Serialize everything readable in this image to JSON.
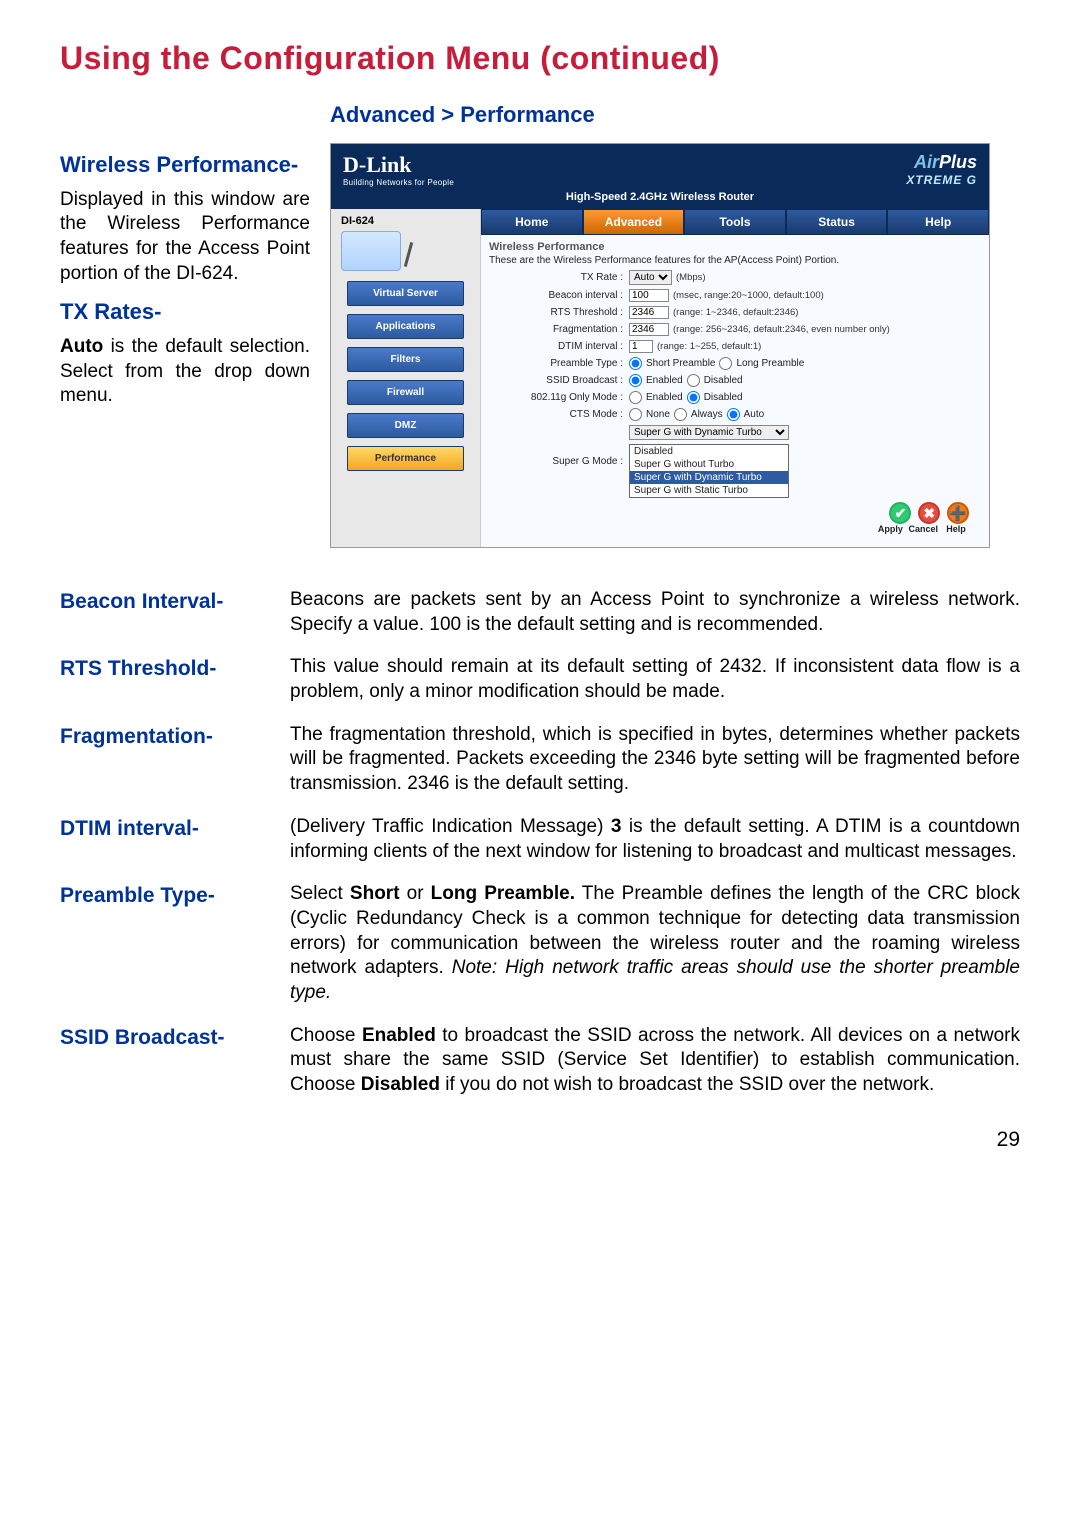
{
  "page": {
    "title": "Using the Configuration Menu (continued)",
    "breadcrumb": "Advanced > Performance",
    "number": "29"
  },
  "left": {
    "wireless_perf_label": "Wireless Performance-",
    "wireless_perf_text": "Displayed in this window are the Wireless Performance features for the Access Point portion of the DI-624.",
    "tx_rates_label": "TX Rates-",
    "tx_rates_auto": "Auto",
    "tx_rates_text": " is the default selection. Select from the drop down menu."
  },
  "router": {
    "logo": "D-Link",
    "logo_sub": "Building Networks for People",
    "brand_air": "Air",
    "brand_plus": "Plus",
    "brand_xtreme": "XTREME G",
    "subheader": "High-Speed 2.4GHz Wireless Router",
    "model": "DI-624",
    "side_items": [
      "Virtual Server",
      "Applications",
      "Filters",
      "Firewall",
      "DMZ",
      "Performance"
    ],
    "tabs": [
      "Home",
      "Advanced",
      "Tools",
      "Status",
      "Help"
    ],
    "panel_title": "Wireless Performance",
    "panel_desc": "These are the Wireless Performance features for the AP(Access Point) Portion.",
    "rows": {
      "tx_rate": {
        "label": "TX Rate :",
        "value": "Auto",
        "unit": "(Mbps)"
      },
      "beacon": {
        "label": "Beacon interval :",
        "value": "100",
        "hint": "(msec, range:20~1000, default:100)"
      },
      "rts": {
        "label": "RTS Threshold :",
        "value": "2346",
        "hint": "(range: 1~2346, default:2346)"
      },
      "frag": {
        "label": "Fragmentation :",
        "value": "2346",
        "hint": "(range: 256~2346, default:2346, even number only)"
      },
      "dtim": {
        "label": "DTIM interval :",
        "value": "1",
        "hint": "(range: 1~255, default:1)"
      },
      "preamble": {
        "label": "Preamble Type :",
        "opt1": "Short Preamble",
        "opt2": "Long Preamble"
      },
      "ssid": {
        "label": "SSID Broadcast :",
        "opt1": "Enabled",
        "opt2": "Disabled"
      },
      "gonly": {
        "label": "802.11g Only Mode :",
        "opt1": "Enabled",
        "opt2": "Disabled"
      },
      "cts": {
        "label": "CTS Mode :",
        "opt1": "None",
        "opt2": "Always",
        "opt3": "Auto"
      },
      "superg": {
        "label": "Super G Mode :",
        "value": "Super G with Dynamic Turbo"
      }
    },
    "dropdown": [
      "Disabled",
      "Super G without Turbo",
      "Super G with Dynamic Turbo",
      "Super G with Static Turbo"
    ],
    "actions": {
      "apply": "Apply",
      "cancel": "Cancel",
      "help": "Help"
    }
  },
  "defs": {
    "beacon": {
      "term": "Beacon Interval-",
      "body": "Beacons are packets sent by an Access Point to synchronize a wireless network. Specify a value. 100 is the default setting and is recommended."
    },
    "rts": {
      "term": "RTS Threshold-",
      "body": "This value should remain at its default setting of 2432. If inconsistent data flow is a problem, only a minor modification should be made."
    },
    "frag": {
      "term": "Fragmentation-",
      "body": "The fragmentation threshold, which is specified in bytes, determines whether packets will be fragmented. Packets exceeding the 2346 byte setting will be fragmented before transmission. 2346 is the default setting."
    },
    "dtim": {
      "term": "DTIM interval-",
      "pre": "(Delivery Traffic Indication Message) ",
      "bold": "3",
      "post": " is the default setting. A DTIM is a countdown informing clients of the next window for listening to broadcast and multicast messages."
    },
    "preamble": {
      "term": "Preamble Type-",
      "p1": "Select ",
      "b1": "Short",
      "p2": " or ",
      "b2": "Long Preamble.",
      "p3": " The Preamble defines the length of the CRC block (Cyclic Redundancy Check is a common technique for detecting data transmission errors) for communication between the wireless router and the roaming wireless network adapters. ",
      "note": "Note: High network traffic areas should use the shorter preamble type."
    },
    "ssid": {
      "term": "SSID Broadcast-",
      "p1": "Choose ",
      "b1": "Enabled",
      "p2": " to broadcast the SSID across the network. All devices on a network must share the same SSID (Service Set Identifier) to establish communication. Choose ",
      "b2": "Disabled",
      "p3": " if you do not wish to broadcast the SSID over the network."
    }
  }
}
